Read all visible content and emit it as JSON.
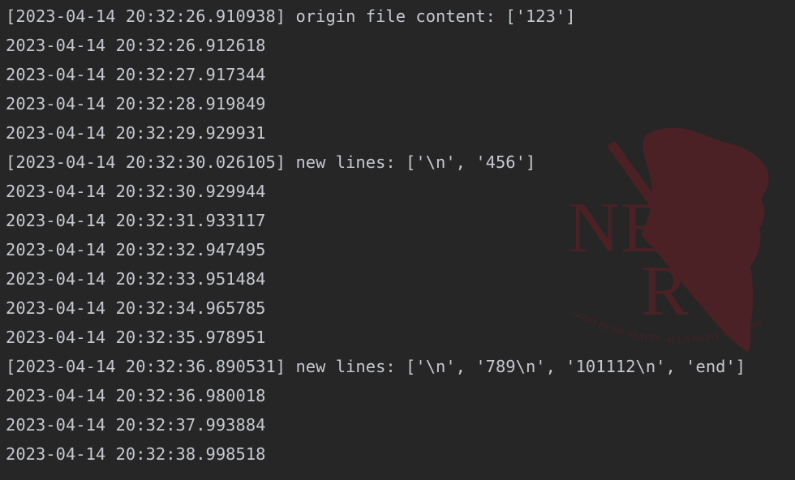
{
  "console": {
    "lines": [
      "[2023-04-14 20:32:26.910938] origin file content: ['123']",
      "2023-04-14 20:32:26.912618",
      "2023-04-14 20:32:27.917344",
      "2023-04-14 20:32:28.919849",
      "2023-04-14 20:32:29.929931",
      "[2023-04-14 20:32:30.026105] new lines: ['\\n', '456']",
      "2023-04-14 20:32:30.929944",
      "2023-04-14 20:32:31.933117",
      "2023-04-14 20:32:32.947495",
      "2023-04-14 20:32:33.951484",
      "2023-04-14 20:32:34.965785",
      "2023-04-14 20:32:35.978951",
      "[2023-04-14 20:32:36.890531] new lines: ['\\n', '789\\n', '101112\\n', 'end']",
      "2023-04-14 20:32:36.980018",
      "2023-04-14 20:32:37.993884",
      "2023-04-14 20:32:38.998518"
    ]
  },
  "watermark": {
    "logo_text_1": "NE",
    "logo_text_2": "RV",
    "motto": "GOD'S IN HIS HEAVEN. ALL'S RIGHT WITH THE WORLD.",
    "color": "#8b1d26",
    "icon": "nerv-logo-icon"
  },
  "colors": {
    "background": "#262626",
    "text": "#c5c9cf"
  }
}
